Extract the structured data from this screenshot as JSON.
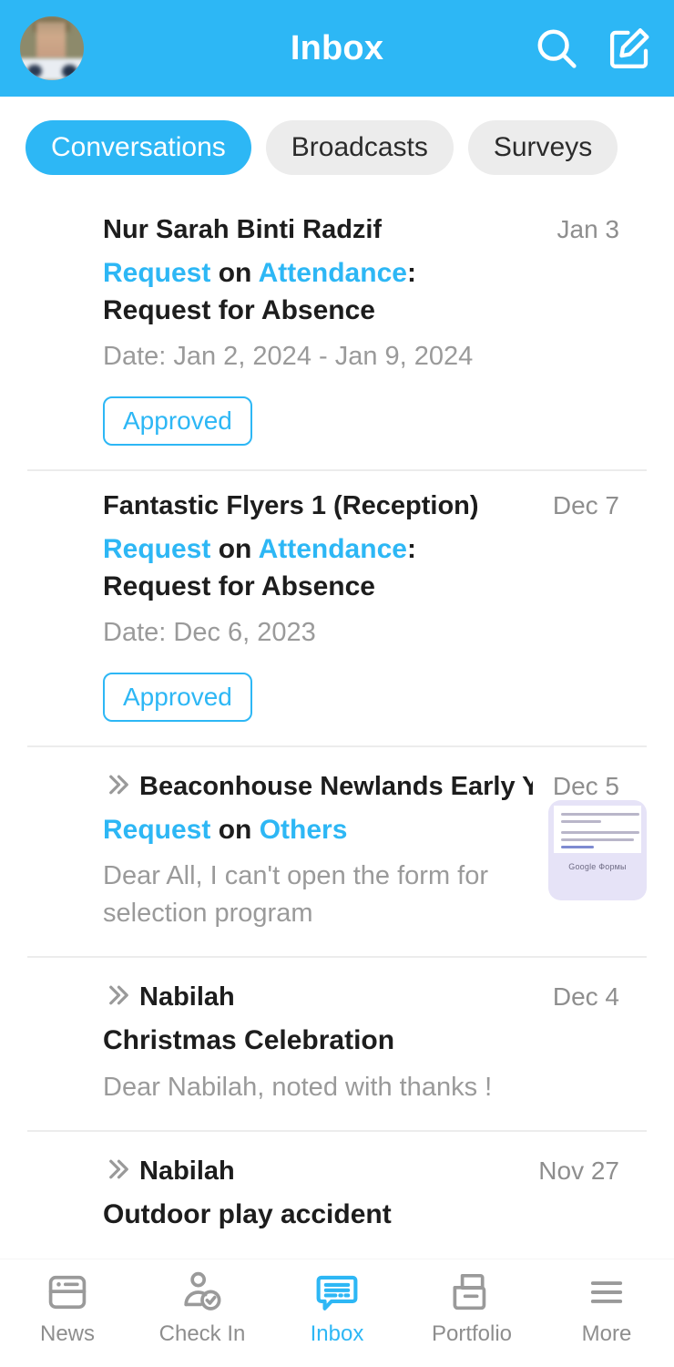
{
  "theme": {
    "accent": "#2DB7F5",
    "header_bg": "#2DB7F5",
    "tab_inactive_bg": "#ececec",
    "muted_text": "#9a9a9a",
    "title_text": "#1d1d1d"
  },
  "header": {
    "title": "Inbox",
    "avatar_name": "user-avatar",
    "search_icon": "search-icon",
    "compose_icon": "compose-icon"
  },
  "tabs": [
    {
      "label": "Conversations",
      "active": true
    },
    {
      "label": "Broadcasts",
      "active": false
    },
    {
      "label": "Surveys",
      "active": false
    }
  ],
  "conversations": [
    {
      "sender": "Nur Sarah Binti Radzif",
      "date": "Jan 3",
      "has_chevron": false,
      "subject_prefix": "Request",
      "subject_middle": " on ",
      "subject_category": "Attendance",
      "subject_suffix": ":",
      "subject_line2": "Request for Absence",
      "preview": "Date: Jan 2, 2024 - Jan 9, 2024",
      "badge": "Approved",
      "thumbnail": false
    },
    {
      "sender": "Fantastic Flyers 1 (Reception)",
      "date": "Dec 7",
      "has_chevron": false,
      "subject_prefix": "Request",
      "subject_middle": " on ",
      "subject_category": "Attendance",
      "subject_suffix": ":",
      "subject_line2": "Request for Absence",
      "preview": "Date: Dec 6, 2023",
      "badge": "Approved",
      "thumbnail": false
    },
    {
      "sender": "Beaconhouse Newlands Early Years Am…",
      "date": "Dec 5",
      "has_chevron": true,
      "subject_prefix": "Request",
      "subject_middle": " on ",
      "subject_category": "Others",
      "subject_suffix": "",
      "subject_line2": "",
      "preview": "Dear All, I can't open the form for selection program",
      "badge": "",
      "thumbnail": true,
      "thumbnail_caption": "Google Формы"
    },
    {
      "sender": "Nabilah",
      "date": "Dec 4",
      "has_chevron": true,
      "subject_prefix": "",
      "subject_middle": "",
      "subject_category": "",
      "subject_suffix": "",
      "subject_line2": "Christmas Celebration",
      "preview": "Dear Nabilah, noted with thanks !",
      "badge": "",
      "thumbnail": false
    },
    {
      "sender": "Nabilah",
      "date": "Nov 27",
      "has_chevron": true,
      "subject_prefix": "",
      "subject_middle": "",
      "subject_category": "",
      "subject_suffix": "",
      "subject_line2": "Outdoor play accident",
      "preview": "",
      "badge": "",
      "thumbnail": false
    }
  ],
  "bottom_nav": [
    {
      "label": "News",
      "icon": "news-icon",
      "active": false
    },
    {
      "label": "Check In",
      "icon": "check-in-icon",
      "active": false
    },
    {
      "label": "Inbox",
      "icon": "inbox-icon",
      "active": true
    },
    {
      "label": "Portfolio",
      "icon": "portfolio-icon",
      "active": false
    },
    {
      "label": "More",
      "icon": "more-icon",
      "active": false
    }
  ]
}
